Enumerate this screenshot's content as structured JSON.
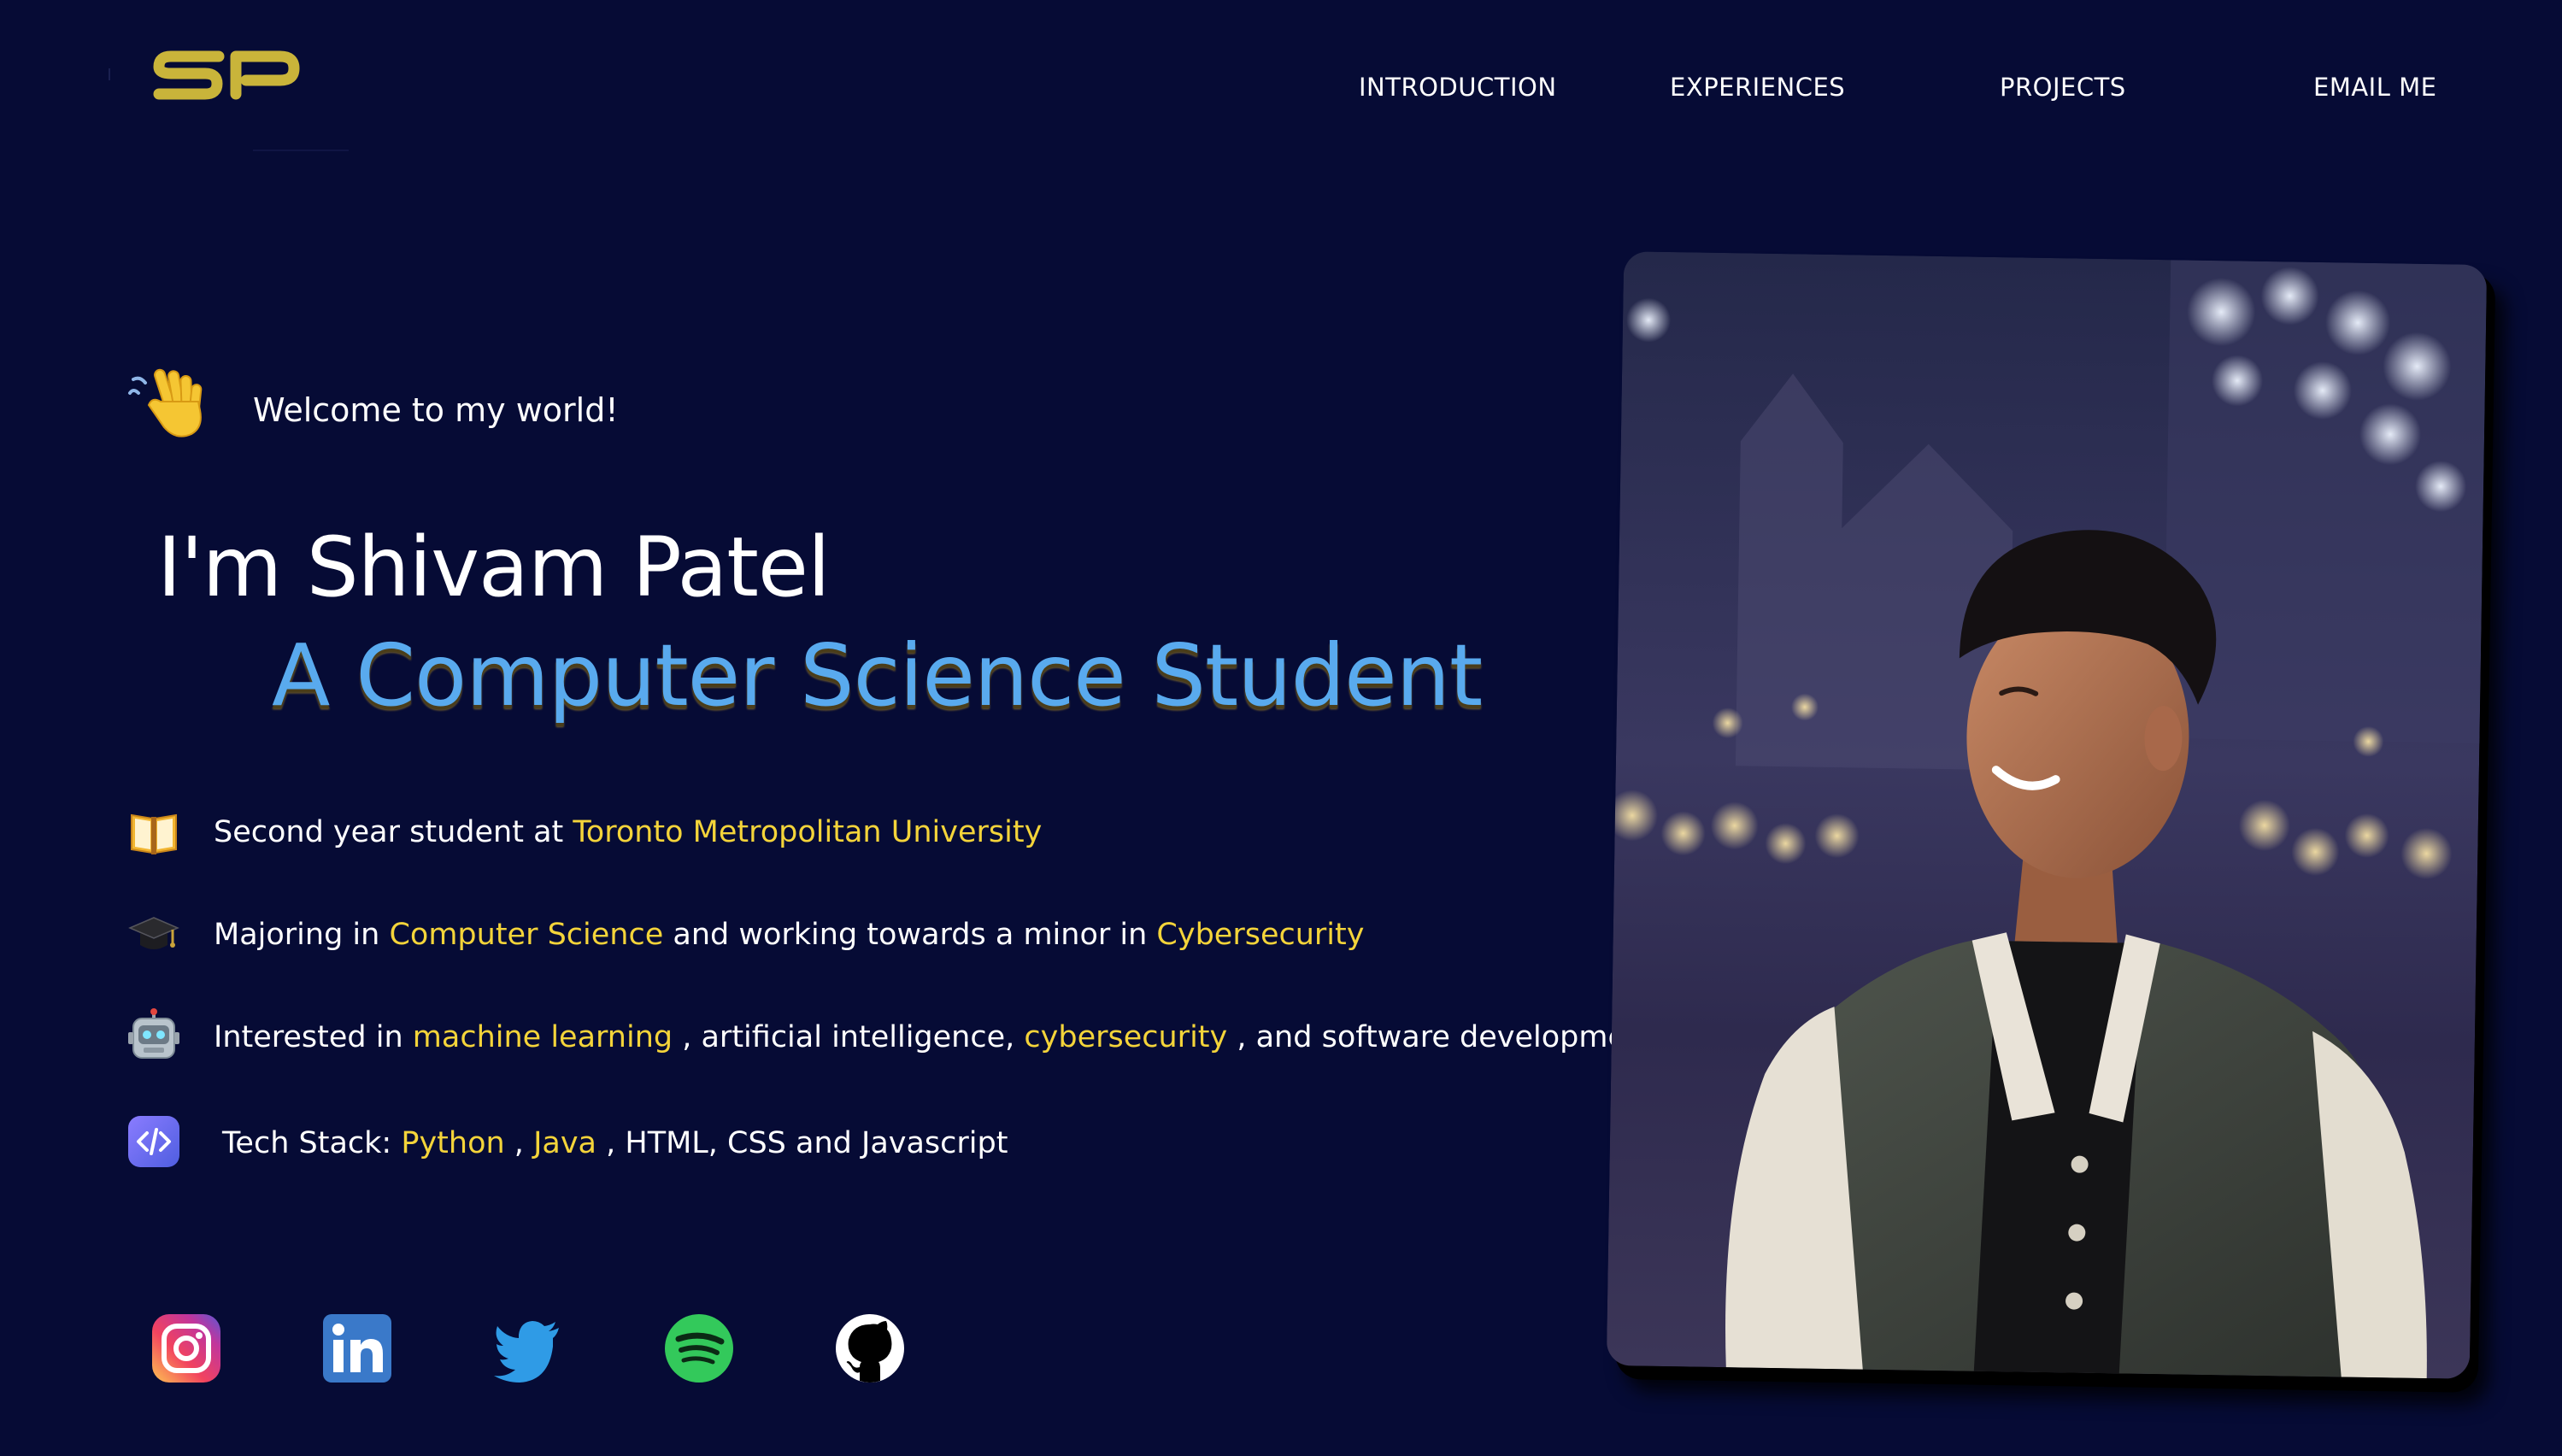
{
  "logo": {
    "text": "SP",
    "color": "#c9b43a"
  },
  "nav": {
    "items": [
      {
        "label": "INTRODUCTION"
      },
      {
        "label": "EXPERIENCES"
      },
      {
        "label": "PROJECTS"
      },
      {
        "label": "EMAIL ME"
      }
    ]
  },
  "hero": {
    "welcome_icon": "waving-hand-icon",
    "welcome": "Welcome to my world!",
    "name": "I'm Shivam Patel",
    "role": "A Computer Science Student",
    "role_color": "#59aaee"
  },
  "facts": [
    {
      "icon": "book-icon",
      "parts": [
        {
          "t": "Second year student at ",
          "hl": false
        },
        {
          "t": "Toronto Metropolitan University",
          "hl": true
        }
      ]
    },
    {
      "icon": "graduation-cap-icon",
      "parts": [
        {
          "t": "Majoring in ",
          "hl": false
        },
        {
          "t": "Computer Science",
          "hl": true
        },
        {
          "t": " and working towards a minor in ",
          "hl": false
        },
        {
          "t": "Cybersecurity",
          "hl": true
        }
      ]
    },
    {
      "icon": "robot-icon",
      "parts": [
        {
          "t": "Interested in ",
          "hl": false
        },
        {
          "t": "machine learning",
          "hl": true
        },
        {
          "t": " , artificial intelligence, ",
          "hl": false
        },
        {
          "t": "cybersecurity",
          "hl": true
        },
        {
          "t": " , and software development!",
          "hl": false
        }
      ]
    },
    {
      "icon": "code-icon",
      "parts": [
        {
          "t": "Tech Stack: ",
          "hl": false
        },
        {
          "t": "Python",
          "hl": true
        },
        {
          "t": " , ",
          "hl": false
        },
        {
          "t": "Java",
          "hl": true
        },
        {
          "t": " , HTML, CSS and Javascript",
          "hl": false
        }
      ]
    }
  ],
  "highlight_color": "#f4d43a",
  "socials": [
    {
      "name": "instagram-icon"
    },
    {
      "name": "linkedin-icon"
    },
    {
      "name": "twitter-icon"
    },
    {
      "name": "spotify-icon"
    },
    {
      "name": "github-icon"
    }
  ],
  "photo": {
    "subject": "portrait-photo"
  }
}
